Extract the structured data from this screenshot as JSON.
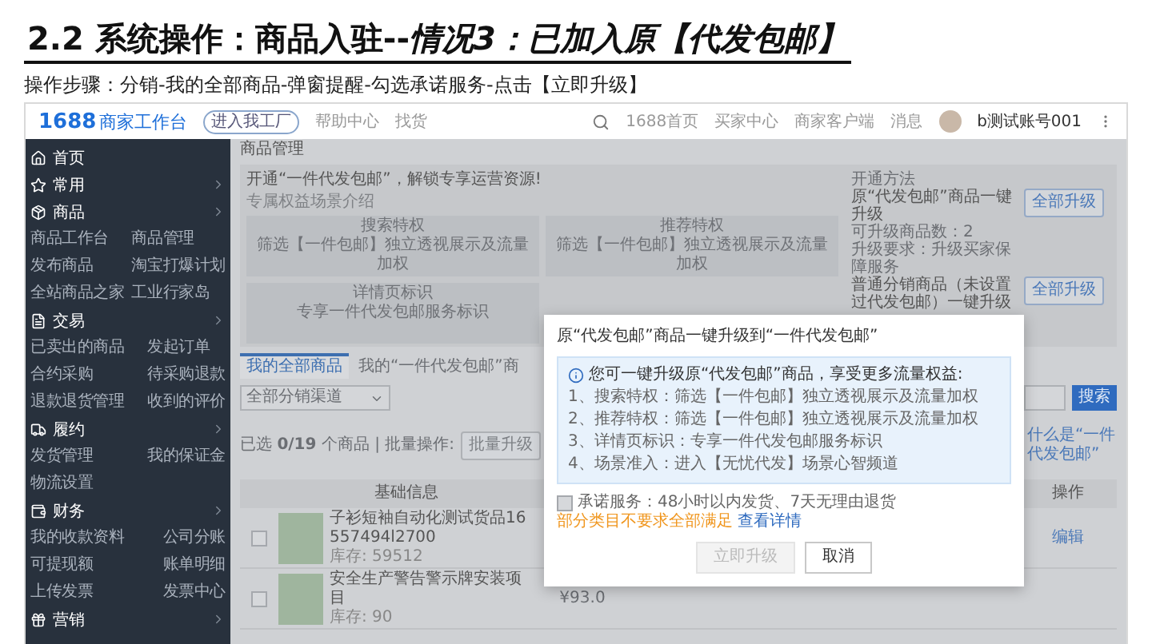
{
  "slide": {
    "title": "2.2 系统操作：商品入驻--*情况3：已加入原【代发包邮】*",
    "steps": "操作步骤：分销-我的全部商品-弹窗提醒-勾选承诺服务-点击【立即升级】"
  },
  "header": {
    "logo_number": "1688",
    "logo_text": "商家工作台",
    "badge": "进入我工厂",
    "links": [
      "帮助中心",
      "找货"
    ],
    "nav": [
      "1688首页",
      "买家中心",
      "商家客户端",
      "消息"
    ],
    "account": "b测试账号001"
  },
  "sidebar": [
    {
      "label": "首页",
      "expandable": false
    },
    {
      "label": "常用",
      "expandable": true
    },
    {
      "label": "商品",
      "expandable": true,
      "children": [
        "商品工作台",
        "商品管理",
        "发布商品",
        "淘宝打爆计划",
        "全站商品之家",
        "工业行家岛"
      ]
    },
    {
      "label": "交易",
      "expandable": true,
      "children": [
        "已卖出的商品",
        "发起订单",
        "合约采购",
        "待采购退款",
        "退款退货管理",
        "收到的评价"
      ]
    },
    {
      "label": "履约",
      "expandable": true,
      "children": [
        "发货管理",
        "我的保证金",
        "物流设置"
      ]
    },
    {
      "label": "财务",
      "expandable": true,
      "children": [
        "我的收款资料",
        "公司分账",
        "可提现额",
        "账单明细",
        "上传发票",
        "发票中心"
      ]
    },
    {
      "label": "营销",
      "expandable": true
    }
  ],
  "page": {
    "title": "商品管理",
    "promo": {
      "headline": "开通“一件代发包邮”，解锁专享运营资源!",
      "subtitle": "专属权益场景介绍",
      "cards": [
        {
          "title": "搜索特权",
          "text": "筛选【一件包邮】独立透视展示及流量加权"
        },
        {
          "title": "推荐特权",
          "text": "筛选【一件包邮】独立透视展示及流量加权"
        },
        {
          "title": "详情页标识",
          "text": "专享一件代发包邮服务标识"
        }
      ]
    },
    "methods": {
      "title": "开通方法",
      "items": [
        {
          "title": "原“代发包邮”商品一键升级",
          "lines": [
            "可升级商品数：2",
            "升级要求：升级买家保障服务"
          ],
          "button": "全部升级"
        },
        {
          "title": "普通分销商品（未设置过代发包邮）一键升级",
          "button": "全部升级"
        }
      ]
    },
    "tabs": [
      {
        "label": "我的全部商品",
        "selected": true
      },
      {
        "label": "我的“一件代发包邮”商",
        "selected": false
      }
    ],
    "filter": {
      "channel": "全部分销渠道",
      "search_button": "搜索"
    },
    "selection": {
      "summary": "已选 **0/19** 个商品 | 批量操作:",
      "batch_button": "批量升级",
      "help_link": "什么是“一件代发包邮”"
    },
    "table": {
      "columns": [
        {
          "kind": "info",
          "label": "基础信息"
        },
        {
          "kind": "action",
          "label": "操作"
        }
      ],
      "rows": [
        {
          "name": "子衫短袖自动化测试货品16557494l2700",
          "stock": "库存: 59512",
          "checked": false,
          "action": "编辑"
        },
        {
          "name": "安全生产警告警示牌安装项目",
          "stock": "库存: 90",
          "checked": false,
          "price": "¥93.0"
        }
      ]
    }
  },
  "dialog": {
    "title": "原“代发包邮”商品一键升级到“一件代发包邮”",
    "notice": "您可一键升级原“代发包邮”商品，享受更多流量权益:",
    "benefits": [
      "1、搜索特权：筛选【一件包邮】独立透视展示及流量加权",
      "2、推荐特权：筛选【一件包邮】独立透视展示及流量加权",
      "3、详情页标识：专享一件代发包邮服务标识",
      "4、场景准入：进入【无忧代发】场景心智频道"
    ],
    "promise": {
      "checked": false,
      "text": "承诺服务：48小时以内发货、7天无理由退货",
      "warning": "部分类目不要求全部满足",
      "link": "查看详情"
    },
    "buttons": [
      {
        "label": "立即升级",
        "disabled": true
      },
      {
        "label": "取消",
        "disabled": false
      }
    ]
  }
}
